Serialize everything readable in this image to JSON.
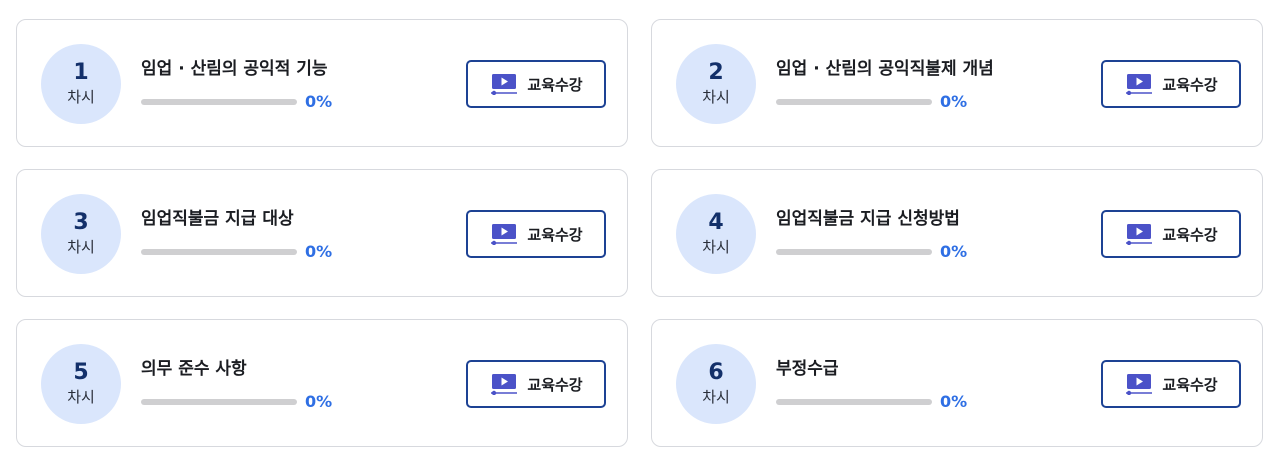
{
  "unit_label": "차시",
  "button_label": "교육수강",
  "colors": {
    "circle_bg": "#dae6fc",
    "accent": "#2f6fe4",
    "button_border": "#1d4294",
    "video_icon": "#4b52c8"
  },
  "lessons": [
    {
      "number": "1",
      "title": "임업 · 산림의 공익적 기능",
      "progress": 0,
      "progress_text": "0%"
    },
    {
      "number": "2",
      "title": "임업 · 산림의 공익직불제 개념",
      "progress": 0,
      "progress_text": "0%"
    },
    {
      "number": "3",
      "title": "임업직불금 지급 대상",
      "progress": 0,
      "progress_text": "0%"
    },
    {
      "number": "4",
      "title": "임업직불금 지급 신청방법",
      "progress": 0,
      "progress_text": "0%"
    },
    {
      "number": "5",
      "title": "의무 준수 사항",
      "progress": 0,
      "progress_text": "0%"
    },
    {
      "number": "6",
      "title": "부정수급",
      "progress": 0,
      "progress_text": "0%"
    }
  ]
}
